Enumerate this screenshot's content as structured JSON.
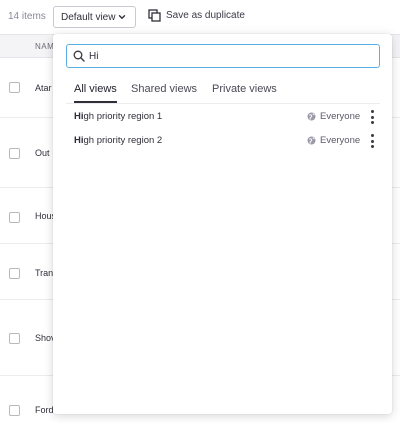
{
  "toolbar": {
    "items_count": "14 items",
    "view_select_label": "Default view",
    "save_duplicate_label": "Save as duplicate"
  },
  "table": {
    "header_name": "NAM",
    "rows": [
      {
        "name": "Atar"
      },
      {
        "name": "Out"
      },
      {
        "name": "Hous"
      },
      {
        "name": "Tran"
      },
      {
        "name": "Shov"
      },
      {
        "name": "Ford"
      }
    ]
  },
  "popover": {
    "search": {
      "value": "Hi",
      "icon": "search-icon"
    },
    "tabs": [
      {
        "label": "All views",
        "active": true
      },
      {
        "label": "Shared views",
        "active": false
      },
      {
        "label": "Private views",
        "active": false
      }
    ],
    "views": [
      {
        "match": "Hi",
        "rest": "gh priority region 1",
        "visibility": "Everyone",
        "visibility_icon": "globe-icon"
      },
      {
        "match": "Hi",
        "rest": "gh priority region 2",
        "visibility": "Everyone",
        "visibility_icon": "globe-icon"
      }
    ]
  },
  "colors": {
    "accent_focus": "#5ab0e6",
    "text": "#2f2f3a",
    "muted": "#8a8a96",
    "header_bg": "#f4f4f6"
  }
}
